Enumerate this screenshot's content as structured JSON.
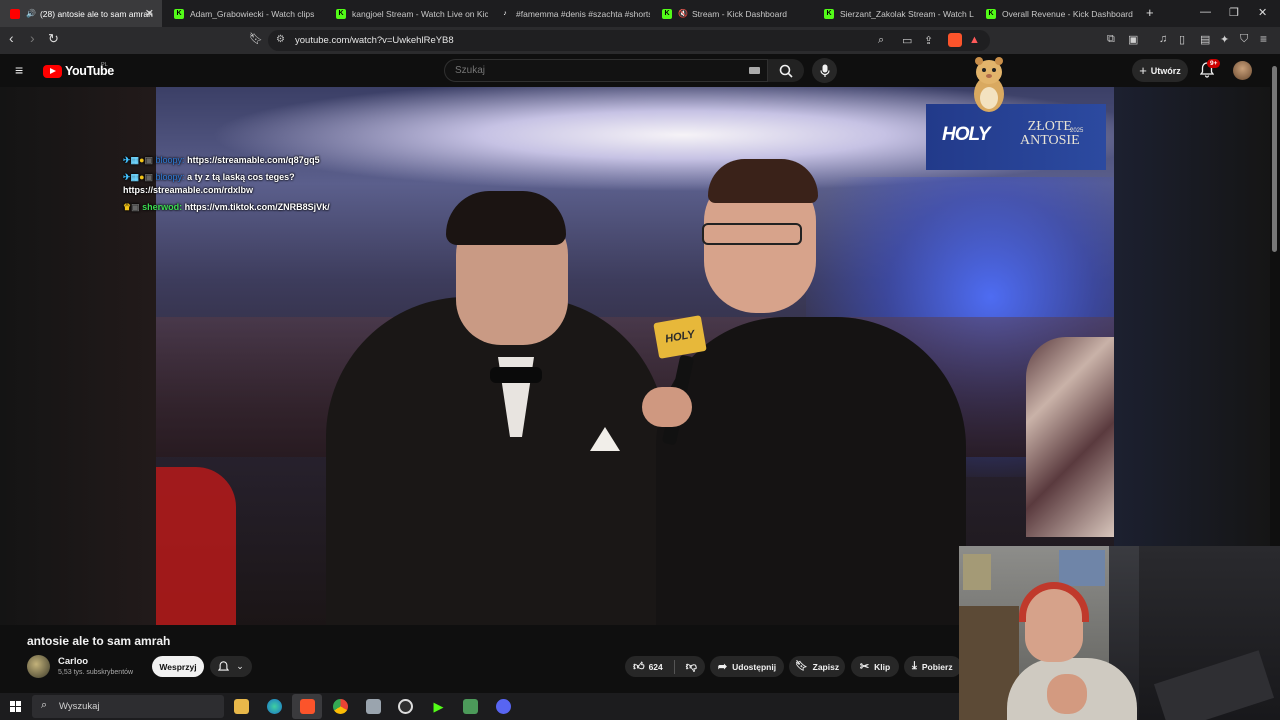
{
  "browser": {
    "tabs": [
      {
        "label": "(28) antosie ale to sam amrah",
        "active": true,
        "favicon": "youtube-icon",
        "color": "#ff0000"
      },
      {
        "label": "Adam_Grabowiecki - Watch clips",
        "active": false,
        "favicon": "kick-icon",
        "color": "#53fc18"
      },
      {
        "label": "kangjoel Stream - Watch Live on Kick",
        "active": false,
        "favicon": "kick-icon",
        "color": "#53fc18"
      },
      {
        "label": "#famemma #denis #szachta #shorts",
        "active": false,
        "favicon": "tiktok-icon",
        "color": "#ffffff"
      },
      {
        "label": "Stream - Kick Dashboard",
        "active": false,
        "favicon": "kick-icon",
        "color": "#53fc18"
      },
      {
        "label": "Sierzant_Zakolak Stream - Watch Live",
        "active": false,
        "favicon": "kick-icon",
        "color": "#53fc18"
      },
      {
        "label": "Overall Revenue - Kick Dashboard",
        "active": false,
        "favicon": "kick-icon",
        "color": "#53fc18"
      }
    ],
    "url": "youtube.com/watch?v=UwkehlReYB8"
  },
  "youtube": {
    "logo_text": "YouTube",
    "country_code": "PL",
    "search_placeholder": "Szukaj",
    "create_label": "Utwórz",
    "notifications_badge": "9+"
  },
  "chat": {
    "lines": [
      {
        "user": "bloopy:",
        "message": "https://streamable.com/q87gq5"
      },
      {
        "user": "bloopy:",
        "message": "a ty z tą laską cos teges?"
      },
      {
        "continuation": "https://streamable.com/rdxlbw"
      },
      {
        "user": "sherwod:",
        "message": "https://vm.tiktok.com/ZNRB8SjVk/"
      }
    ]
  },
  "overlay": {
    "brand": "HOLY",
    "title_line1": "ZŁOTE",
    "title_line2": "ANTOSIE",
    "year": "2025"
  },
  "video": {
    "title": "antosie ale to sam amrah",
    "channel": "Carloo",
    "subscribers": "5,53 tys. subskrybentów",
    "join_label": "Wesprzyj",
    "likes": "624",
    "share_label": "Udostępnij",
    "save_label": "Zapisz",
    "clip_label": "Klip",
    "download_label": "Pobierz"
  },
  "taskbar": {
    "search_placeholder": "Wyszukaj"
  }
}
